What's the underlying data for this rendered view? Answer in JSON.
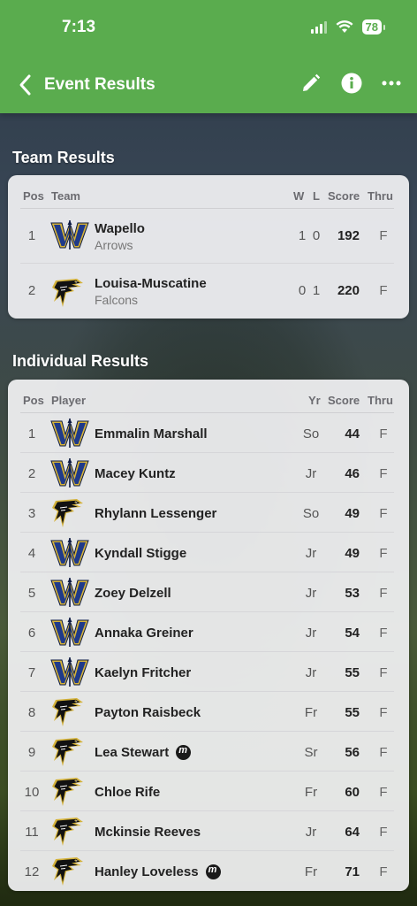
{
  "status": {
    "time": "7:13",
    "battery": "78"
  },
  "nav": {
    "title": "Event Results"
  },
  "team_section": {
    "title": "Team Results",
    "headers": {
      "pos": "Pos",
      "team": "Team",
      "w": "W",
      "l": "L",
      "score": "Score",
      "thru": "Thru"
    },
    "rows": [
      {
        "pos": "1",
        "name": "Wapello",
        "mascot": "Arrows",
        "w": "1",
        "l": "0",
        "score": "192",
        "thru": "F",
        "logo": "W"
      },
      {
        "pos": "2",
        "name": "Louisa-Muscatine",
        "mascot": "Falcons",
        "w": "0",
        "l": "1",
        "score": "220",
        "thru": "F",
        "logo": "falcon"
      }
    ]
  },
  "individual_section": {
    "title": "Individual Results",
    "headers": {
      "pos": "Pos",
      "player": "Player",
      "yr": "Yr",
      "score": "Score",
      "thru": "Thru"
    },
    "rows": [
      {
        "pos": "1",
        "name": "Emmalin Marshall",
        "yr": "So",
        "score": "44",
        "thru": "F",
        "logo": "W",
        "badge": false
      },
      {
        "pos": "2",
        "name": "Macey Kuntz",
        "yr": "Jr",
        "score": "46",
        "thru": "F",
        "logo": "W",
        "badge": false
      },
      {
        "pos": "3",
        "name": "Rhylann Lessenger",
        "yr": "So",
        "score": "49",
        "thru": "F",
        "logo": "falcon",
        "badge": false
      },
      {
        "pos": "4",
        "name": "Kyndall Stigge",
        "yr": "Jr",
        "score": "49",
        "thru": "F",
        "logo": "W",
        "badge": false
      },
      {
        "pos": "5",
        "name": "Zoey Delzell",
        "yr": "Jr",
        "score": "53",
        "thru": "F",
        "logo": "W",
        "badge": false
      },
      {
        "pos": "6",
        "name": "Annaka Greiner",
        "yr": "Jr",
        "score": "54",
        "thru": "F",
        "logo": "W",
        "badge": false
      },
      {
        "pos": "7",
        "name": "Kaelyn Fritcher",
        "yr": "Jr",
        "score": "55",
        "thru": "F",
        "logo": "W",
        "badge": false
      },
      {
        "pos": "8",
        "name": "Payton Raisbeck",
        "yr": "Fr",
        "score": "55",
        "thru": "F",
        "logo": "falcon",
        "badge": false
      },
      {
        "pos": "9",
        "name": "Lea Stewart",
        "yr": "Sr",
        "score": "56",
        "thru": "F",
        "logo": "falcon",
        "badge": true
      },
      {
        "pos": "10",
        "name": "Chloe Rife",
        "yr": "Fr",
        "score": "60",
        "thru": "F",
        "logo": "falcon",
        "badge": false
      },
      {
        "pos": "11",
        "name": "Mckinsie Reeves",
        "yr": "Jr",
        "score": "64",
        "thru": "F",
        "logo": "falcon",
        "badge": false
      },
      {
        "pos": "12",
        "name": "Hanley Loveless",
        "yr": "Fr",
        "score": "71",
        "thru": "F",
        "logo": "falcon",
        "badge": true
      }
    ]
  },
  "colors": {
    "header": "#5aac4e",
    "wapello_blue": "#1f3a8a",
    "wapello_gold": "#d4b23a",
    "falcon_black": "#111111"
  },
  "icons": [
    "back-chevron-icon",
    "edit-pencil-icon",
    "info-icon",
    "more-icon",
    "wifi-icon",
    "signal-icon",
    "battery-icon",
    "wapello-logo-icon",
    "falcon-logo-icon",
    "player-badge-icon"
  ]
}
